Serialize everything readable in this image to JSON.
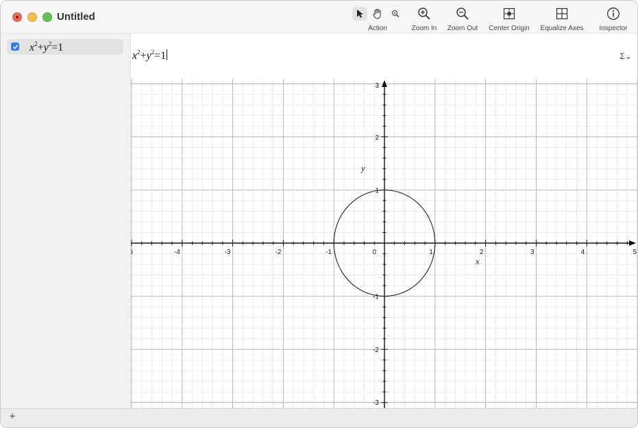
{
  "window": {
    "title": "Untitled"
  },
  "toolbar": {
    "action_label": "Action",
    "zoom_in_label": "Zoom In",
    "zoom_out_label": "Zoom Out",
    "center_origin_label": "Center Origin",
    "equalize_axes_label": "Equalize Axes",
    "inspector_label": "Inspector"
  },
  "sidebar": {
    "equations": [
      {
        "base_x": "x",
        "exp": "2",
        "plus": "+",
        "base_y": "y",
        "exp2": "2",
        "rhs": "=1",
        "checked": true
      }
    ],
    "add_label": "+"
  },
  "editor": {
    "base_x": "x",
    "exp": "2",
    "plus": "+",
    "base_y": "y",
    "exp2": "2",
    "rhs": "=1",
    "sigma_label": "Σ⌄"
  },
  "graph": {
    "x_axis_label": "x",
    "y_axis_label": "y",
    "x_ticks": [
      "5",
      "-4",
      "-3",
      "-2",
      "-1",
      "0",
      "1",
      "2",
      "3",
      "4",
      "5"
    ],
    "y_ticks": [
      "3",
      "2",
      "1",
      "-1",
      "-2",
      "-3"
    ],
    "x_range": [
      -5,
      5
    ],
    "y_range": [
      -3.1,
      3.1
    ],
    "curve": {
      "type": "circle",
      "equation": "x^2+y^2=1",
      "radius": 1,
      "color": "#222222"
    },
    "colors": {
      "major_grid": "#a9a9a9",
      "minor_grid": "#e6e6e6",
      "axis": "#111111"
    }
  }
}
